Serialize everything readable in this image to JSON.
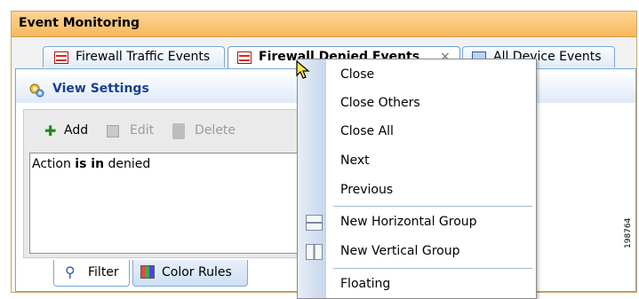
{
  "window": {
    "title": "Event Monitoring"
  },
  "tabs": [
    {
      "label": "Firewall Traffic Events"
    },
    {
      "label": "Firewall Denied Events",
      "close": "×"
    },
    {
      "label": "All Device Events"
    }
  ],
  "view_settings": {
    "title": "View Settings"
  },
  "toolbar": {
    "add": "Add",
    "edit": "Edit",
    "delete": "Delete"
  },
  "filter": {
    "prefix": "Action ",
    "operator": "is in",
    "value": " denied"
  },
  "bottom_tabs": [
    {
      "label": "Filter"
    },
    {
      "label": "Color Rules"
    }
  ],
  "context_menu": {
    "items": [
      "Close",
      "Close Others",
      "Close All",
      "Next",
      "Previous"
    ],
    "group_items": [
      "New Horizontal Group",
      "New Vertical Group"
    ],
    "floating": "Floating"
  },
  "watermark": "198764",
  "colors": {
    "title_bar": "#f6b85c",
    "accent_blue": "#1b3f91",
    "tab_border": "#7aa7d6"
  }
}
